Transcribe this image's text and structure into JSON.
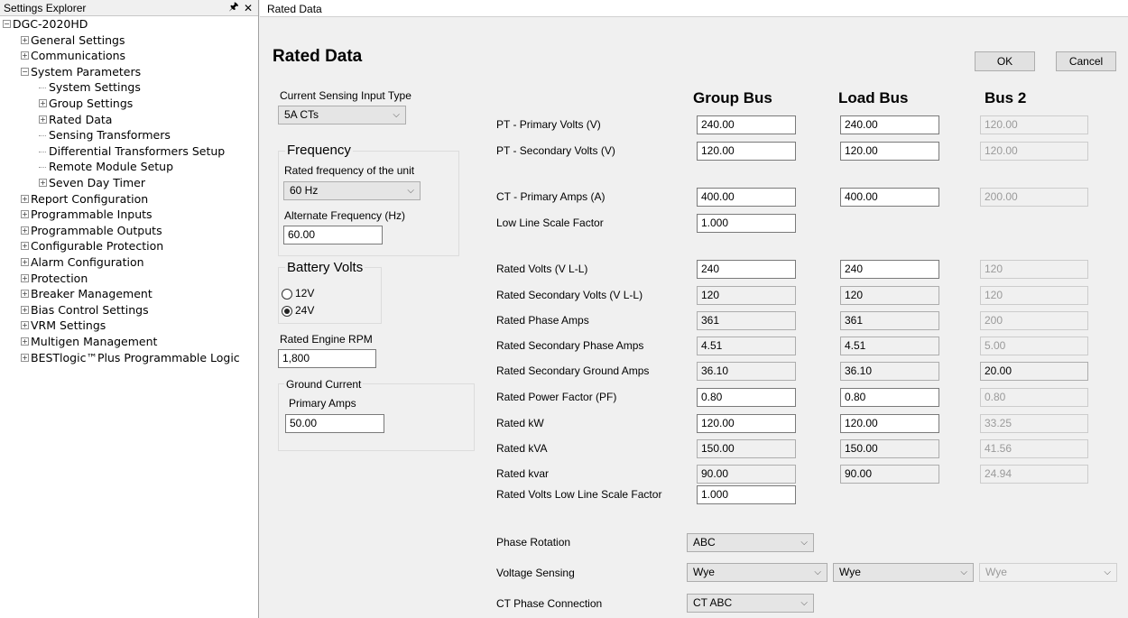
{
  "explorer": {
    "title": "Settings Explorer",
    "pin_icon": "1",
    "close_icon": "✕",
    "tree": [
      {
        "label": "DGC-2020HD",
        "exp": "−"
      },
      {
        "label": "General Settings",
        "exp": "+"
      },
      {
        "label": "Communications",
        "exp": "+"
      },
      {
        "label": "System Parameters",
        "exp": "−"
      },
      {
        "label": "System Settings",
        "exp": ""
      },
      {
        "label": "Group Settings",
        "exp": "+"
      },
      {
        "label": "Rated Data",
        "exp": "+"
      },
      {
        "label": "Sensing Transformers",
        "exp": ""
      },
      {
        "label": "Differential Transformers Setup",
        "exp": ""
      },
      {
        "label": "Remote Module Setup",
        "exp": ""
      },
      {
        "label": "Seven Day Timer",
        "exp": "+"
      },
      {
        "label": "Report Configuration",
        "exp": "+"
      },
      {
        "label": "Programmable Inputs",
        "exp": "+"
      },
      {
        "label": "Programmable Outputs",
        "exp": "+"
      },
      {
        "label": "Configurable Protection",
        "exp": "+"
      },
      {
        "label": "Alarm Configuration",
        "exp": "+"
      },
      {
        "label": "Protection",
        "exp": "+"
      },
      {
        "label": "Breaker Management",
        "exp": "+"
      },
      {
        "label": "Bias Control Settings",
        "exp": "+"
      },
      {
        "label": "VRM Settings",
        "exp": "+"
      },
      {
        "label": "Multigen Management",
        "exp": "+"
      },
      {
        "label": "BESTlogic™Plus Programmable Logic",
        "exp": "+"
      }
    ]
  },
  "doc_tab": "Rated Data",
  "page": {
    "heading": "Rated Data",
    "ok": "OK",
    "cancel": "Cancel",
    "cs_label": "Current Sensing Input Type",
    "cs_value": "5A CTs",
    "freq_title": "Frequency",
    "freq_rated_label": "Rated frequency of the unit",
    "freq_rated_value": "60 Hz",
    "freq_alt_label": "Alternate Frequency (Hz)",
    "freq_alt_value": "60.00",
    "batt_title": "Battery Volts",
    "batt_12": "12V",
    "batt_24": "24V",
    "rpm_label": "Rated Engine RPM",
    "rpm_value": "1,800",
    "gc_title": "Ground Current",
    "gc_label": "Primary Amps",
    "gc_value": "50.00",
    "col_group": "Group Bus",
    "col_load": "Load Bus",
    "col_bus2": "Bus 2",
    "rows": [
      {
        "label": "PT - Primary Volts (V)",
        "g": "240.00",
        "l": "240.00",
        "b": "120.00"
      },
      {
        "label": "PT - Secondary Volts (V)",
        "g": "120.00",
        "l": "120.00",
        "b": "120.00"
      },
      {
        "label": "CT - Primary Amps (A)",
        "g": "400.00",
        "l": "400.00",
        "b": "200.00"
      },
      {
        "label": "Low Line Scale Factor",
        "g": "1.000",
        "l": "",
        "b": ""
      },
      {
        "label": "Rated Volts (V L-L)",
        "g": "240",
        "l": "240",
        "b": "120"
      },
      {
        "label": "Rated Secondary Volts (V L-L)",
        "g": "120",
        "l": "120",
        "b": "120"
      },
      {
        "label": "Rated Phase Amps",
        "g": "361",
        "l": "361",
        "b": "200"
      },
      {
        "label": "Rated Secondary Phase Amps",
        "g": "4.51",
        "l": "4.51",
        "b": "5.00"
      },
      {
        "label": "Rated Secondary Ground Amps",
        "g": "36.10",
        "l": "36.10",
        "b": "20.00"
      },
      {
        "label": "Rated Power Factor (PF)",
        "g": "0.80",
        "l": "0.80",
        "b": "0.80"
      },
      {
        "label": "Rated kW",
        "g": "120.00",
        "l": "120.00",
        "b": "33.25"
      },
      {
        "label": "Rated kVA",
        "g": "150.00",
        "l": "150.00",
        "b": "41.56"
      },
      {
        "label": "Rated kvar",
        "g": "90.00",
        "l": "90.00",
        "b": "24.94"
      },
      {
        "label": "Rated Volts Low Line Scale Factor",
        "g": "1.000",
        "l": "",
        "b": ""
      }
    ],
    "phase_rot_label": "Phase Rotation",
    "phase_rot_value": "ABC",
    "vs_label": "Voltage Sensing",
    "vs_group": "Wye",
    "vs_load": "Wye",
    "vs_bus2": "Wye",
    "ctpc_label": "CT Phase Connection",
    "ctpc_value": "CT ABC"
  }
}
